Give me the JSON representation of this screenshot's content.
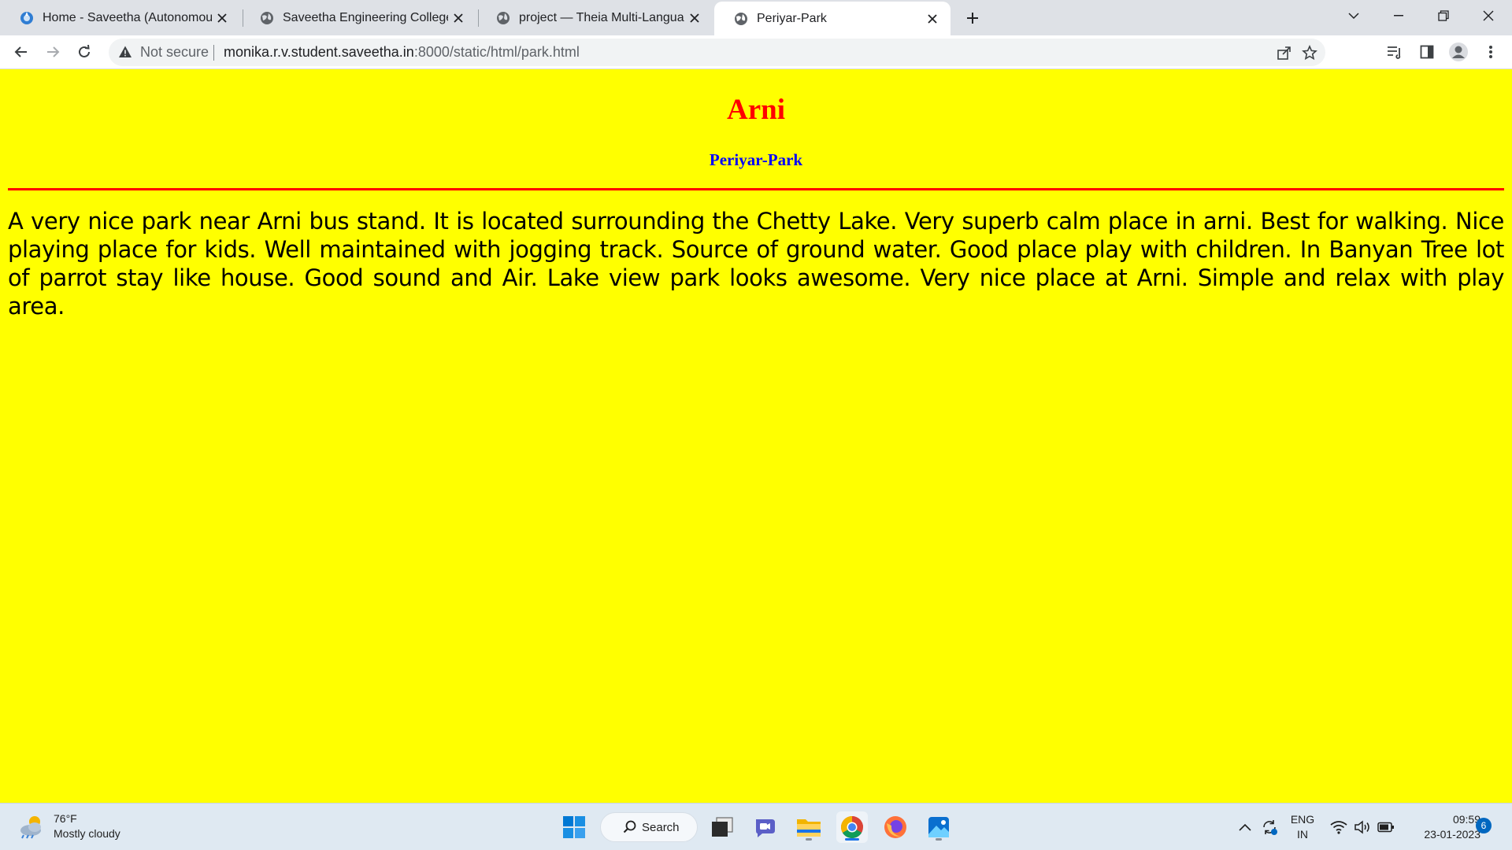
{
  "browser": {
    "tabs": [
      {
        "title": "Home - Saveetha (Autonomous)",
        "active": false
      },
      {
        "title": "Saveetha Engineering College",
        "active": false
      },
      {
        "title": "project — Theia Multi-Language",
        "active": false
      },
      {
        "title": "Periyar-Park",
        "active": true
      }
    ],
    "address": {
      "security": "Not secure",
      "host": "monika.r.v.student.saveetha.in",
      "path": ":8000/static/html/park.html"
    }
  },
  "page": {
    "heading": "Arni",
    "subheading": "Periyar-Park",
    "paragraph": "A very nice park near Arni bus stand. It is located surrounding the Chetty Lake. Very superb calm place in arni. Best for walking. Nice playing place for kids. Well maintained with jogging track. Source of ground water. Good place play with children. In Banyan Tree lot of parrot stay like house. Good sound and Air. Lake view park looks awesome. Very nice place at Arni. Simple and relax with play area.",
    "colors": {
      "background": "#ffff00",
      "heading": "#ff0000",
      "subheading": "#0000ff",
      "rule": "#ff0000"
    }
  },
  "taskbar": {
    "weather": {
      "temp": "76°F",
      "condition": "Mostly cloudy"
    },
    "search_label": "Search",
    "lang": {
      "line1": "ENG",
      "line2": "IN"
    },
    "clock": {
      "time": "09:59",
      "date": "23-01-2023"
    },
    "notifications": "6"
  }
}
